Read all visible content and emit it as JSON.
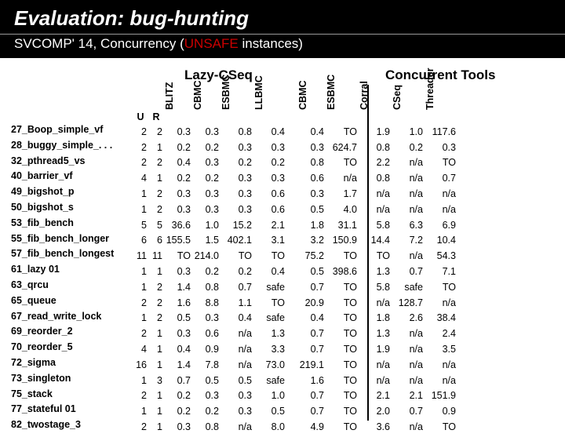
{
  "title": "Evaluation: bug-hunting",
  "subtitle_pre": "SVCOMP' 14, Concurrency (",
  "subtitle_unsafe": "UNSAFE",
  "subtitle_post": " instances)",
  "group1": "Lazy-CSeq",
  "group2": "Concurrent Tools",
  "cols": {
    "u": "U",
    "r": "R",
    "blitz": "BLITZ",
    "cbmc": "CBMC",
    "esbmc": "ESBMC",
    "llbmc": "LLBMC",
    "cbmc2": "CBMC",
    "esbmc2": "ESBMC",
    "corral": "Corral",
    "cseq": "CSeq",
    "threader": "Threader"
  },
  "rows": [
    {
      "name": "27_Boop_simple_vf",
      "u": "2",
      "r": "2",
      "blitz": "0.3",
      "cbmc": "0.3",
      "esbmc": "0.8",
      "llbmc": "0.4",
      "cbmc2": "0.4",
      "esbmc2": "TO",
      "corral": "1.9",
      "cseq": "1.0",
      "th": "117.6"
    },
    {
      "name": "28_buggy_simple_. . .",
      "u": "2",
      "r": "1",
      "blitz": "0.2",
      "cbmc": "0.2",
      "esbmc": "0.3",
      "llbmc": "0.3",
      "cbmc2": "0.3",
      "esbmc2": "624.7",
      "corral": "0.8",
      "cseq": "0.2",
      "th": "0.3"
    },
    {
      "name": "32_pthread5_vs",
      "u": "2",
      "r": "2",
      "blitz": "0.4",
      "cbmc": "0.3",
      "esbmc": "0.2",
      "llbmc": "0.2",
      "cbmc2": "0.8",
      "esbmc2": "TO",
      "corral": "2.2",
      "cseq": "n/a",
      "th": "TO"
    },
    {
      "name": "40_barrier_vf",
      "u": "4",
      "r": "1",
      "blitz": "0.2",
      "cbmc": "0.2",
      "esbmc": "0.3",
      "llbmc": "0.3",
      "cbmc2": "0.6",
      "esbmc2": "n/a",
      "corral": "0.8",
      "cseq": "n/a",
      "th": "0.7"
    },
    {
      "name": "49_bigshot_p",
      "u": "1",
      "r": "2",
      "blitz": "0.3",
      "cbmc": "0.3",
      "esbmc": "0.3",
      "llbmc": "0.6",
      "cbmc2": "0.3",
      "esbmc2": "1.7",
      "corral": "n/a",
      "cseq": "n/a",
      "th": "n/a"
    },
    {
      "name": "50_bigshot_s",
      "u": "1",
      "r": "2",
      "blitz": "0.3",
      "cbmc": "0.3",
      "esbmc": "0.3",
      "llbmc": "0.6",
      "cbmc2": "0.5",
      "esbmc2": "4.0",
      "corral": "n/a",
      "cseq": "n/a",
      "th": "n/a"
    },
    {
      "name": "53_fib_bench",
      "u": "5",
      "r": "5",
      "blitz": "36.6",
      "cbmc": "1.0",
      "esbmc": "15.2",
      "llbmc": "2.1",
      "cbmc2": "1.8",
      "esbmc2": "31.1",
      "corral": "5.8",
      "cseq": "6.3",
      "th": "6.9"
    },
    {
      "name": "55_fib_bench_longer",
      "u": "6",
      "r": "6",
      "blitz": "155.5",
      "cbmc": "1.5",
      "esbmc": "402.1",
      "llbmc": "3.1",
      "cbmc2": "3.2",
      "esbmc2": "150.9",
      "corral": "14.4",
      "cseq": "7.2",
      "th": "10.4"
    },
    {
      "name": "57_fib_bench_longest",
      "u": "11",
      "r": "11",
      "blitz": "TO",
      "cbmc": "214.0",
      "esbmc": "TO",
      "llbmc": "TO",
      "cbmc2": "75.2",
      "esbmc2": "TO",
      "corral": "TO",
      "cseq": "n/a",
      "th": "54.3"
    },
    {
      "name": "61_lazy 01",
      "u": "1",
      "r": "1",
      "blitz": "0.3",
      "cbmc": "0.2",
      "esbmc": "0.2",
      "llbmc": "0.4",
      "cbmc2": "0.5",
      "esbmc2": "398.6",
      "corral": "1.3",
      "cseq": "0.7",
      "th": "7.1"
    },
    {
      "name": "63_qrcu",
      "u": "1",
      "r": "2",
      "blitz": "1.4",
      "cbmc": "0.8",
      "esbmc": "0.7",
      "llbmc": "safe",
      "cbmc2": "0.7",
      "esbmc2": "TO",
      "corral": "5.8",
      "cseq": "safe",
      "th": "TO"
    },
    {
      "name": "65_queue",
      "u": "2",
      "r": "2",
      "blitz": "1.6",
      "cbmc": "8.8",
      "esbmc": "1.1",
      "llbmc": "TO",
      "cbmc2": "20.9",
      "esbmc2": "TO",
      "corral": "n/a",
      "cseq": "128.7",
      "th": "n/a"
    },
    {
      "name": "67_read_write_lock",
      "u": "1",
      "r": "2",
      "blitz": "0.5",
      "cbmc": "0.3",
      "esbmc": "0.4",
      "llbmc": "safe",
      "cbmc2": "0.4",
      "esbmc2": "TO",
      "corral": "1.8",
      "cseq": "2.6",
      "th": "38.4"
    },
    {
      "name": "69_reorder_2",
      "u": "2",
      "r": "1",
      "blitz": "0.3",
      "cbmc": "0.6",
      "esbmc": "n/a",
      "llbmc": "1.3",
      "cbmc2": "0.7",
      "esbmc2": "TO",
      "corral": "1.3",
      "cseq": "n/a",
      "th": "2.4"
    },
    {
      "name": "70_reorder_5",
      "u": "4",
      "r": "1",
      "blitz": "0.4",
      "cbmc": "0.9",
      "esbmc": "n/a",
      "llbmc": "3.3",
      "cbmc2": "0.7",
      "esbmc2": "TO",
      "corral": "1.9",
      "cseq": "n/a",
      "th": "3.5"
    },
    {
      "name": "72_sigma",
      "u": "16",
      "r": "1",
      "blitz": "1.4",
      "cbmc": "7.8",
      "esbmc": "n/a",
      "llbmc": "73.0",
      "cbmc2": "219.1",
      "esbmc2": "TO",
      "corral": "n/a",
      "cseq": "n/a",
      "th": "n/a"
    },
    {
      "name": "73_singleton",
      "u": "1",
      "r": "3",
      "blitz": "0.7",
      "cbmc": "0.5",
      "esbmc": "0.5",
      "llbmc": "safe",
      "cbmc2": "1.6",
      "esbmc2": "TO",
      "corral": "n/a",
      "cseq": "n/a",
      "th": "n/a"
    },
    {
      "name": "75_stack",
      "u": "2",
      "r": "1",
      "blitz": "0.2",
      "cbmc": "0.3",
      "esbmc": "0.3",
      "llbmc": "1.0",
      "cbmc2": "0.7",
      "esbmc2": "TO",
      "corral": "2.1",
      "cseq": "2.1",
      "th": "151.9"
    },
    {
      "name": "77_stateful 01",
      "u": "1",
      "r": "1",
      "blitz": "0.2",
      "cbmc": "0.2",
      "esbmc": "0.3",
      "llbmc": "0.5",
      "cbmc2": "0.7",
      "esbmc2": "TO",
      "corral": "2.0",
      "cseq": "0.7",
      "th": "0.9"
    },
    {
      "name": "82_twostage_3",
      "u": "2",
      "r": "1",
      "blitz": "0.3",
      "cbmc": "0.8",
      "esbmc": "n/a",
      "llbmc": "8.0",
      "cbmc2": "4.9",
      "esbmc2": "TO",
      "corral": "3.6",
      "cseq": "n/a",
      "th": "TO"
    }
  ]
}
